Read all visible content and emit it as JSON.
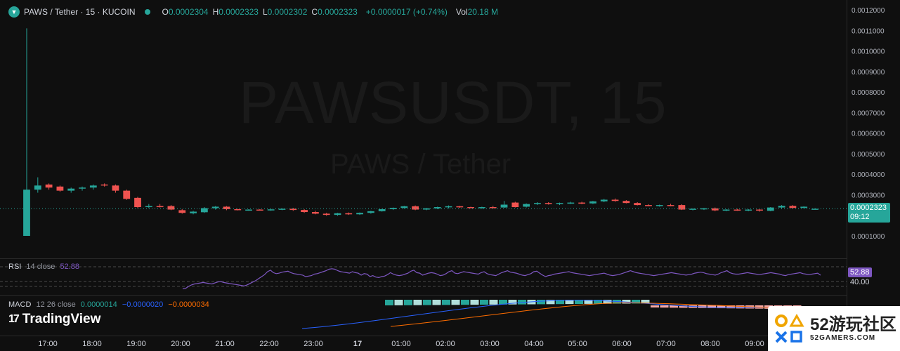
{
  "header": {
    "symbol_title": "PAWS / Tether · 15 · KUCOIN",
    "ohlc": [
      {
        "k": "O",
        "v": "0.0002304"
      },
      {
        "k": "H",
        "v": "0.0002323"
      },
      {
        "k": "L",
        "v": "0.0002302"
      },
      {
        "k": "C",
        "v": "0.0002323"
      }
    ],
    "change": "+0.0000017 (+0.74%)",
    "vol_label": "Vol",
    "vol_value": "20.18 M"
  },
  "watermark": {
    "line1": "PAWSUSDT, 15",
    "line2": "PAWS / Tether"
  },
  "price_tag": {
    "price": "0.0002323",
    "countdown": "09:12"
  },
  "rsi": {
    "label": "RSI",
    "params": "14 close",
    "value": "52.88",
    "level": "40.00"
  },
  "macd": {
    "label": "MACD",
    "params": "12 26 close",
    "hist": "0.0000014",
    "macd": "−0.0000020",
    "signal": "−0.0000034",
    "tag": "0.0000014"
  },
  "branding": {
    "tradingview": "TradingView",
    "badge_big": "52游玩社区",
    "badge_small": "52GAMERS.COM"
  },
  "colors": {
    "up": "#26a69a",
    "down": "#ef5350",
    "rsi": "#7e57c2",
    "macd": "#2962ff",
    "signal": "#ff6d00",
    "bg": "#0f0f0f"
  },
  "chart_data": [
    {
      "type": "candlestick",
      "title": "PAWSUSDT, 15",
      "ylim": [
        8e-05,
        0.00121
      ],
      "yticks": [
        "0.0012000",
        "0.0011000",
        "0.0010000",
        "0.0009000",
        "0.0008000",
        "0.0007000",
        "0.0006000",
        "0.0005000",
        "0.0004000",
        "0.0003000",
        "0.0001000"
      ],
      "xticks": [
        "17:00",
        "18:00",
        "19:00",
        "20:00",
        "21:00",
        "22:00",
        "23:00",
        "17",
        "01:00",
        "02:00",
        "03:00",
        "04:00",
        "05:00",
        "06:00",
        "07:00",
        "08:00",
        "09:00"
      ],
      "candles": [
        [
          0.0001,
          0.00111,
          0.0001,
          0.000325
        ],
        [
          0.000325,
          0.000385,
          0.00031,
          0.000345
        ],
        [
          0.00035,
          0.000355,
          0.000325,
          0.000335
        ],
        [
          0.00034,
          0.000345,
          0.000315,
          0.00032
        ],
        [
          0.00032,
          0.000335,
          0.00031,
          0.00033
        ],
        [
          0.00033,
          0.00034,
          0.00032,
          0.000335
        ],
        [
          0.000335,
          0.00035,
          0.000325,
          0.000345
        ],
        [
          0.00035,
          0.000355,
          0.00034,
          0.000345
        ],
        [
          0.000345,
          0.00035,
          0.00031,
          0.00032
        ],
        [
          0.00032,
          0.000325,
          0.000275,
          0.00028
        ],
        [
          0.000285,
          0.00029,
          0.000235,
          0.00024
        ],
        [
          0.00024,
          0.000255,
          0.000235,
          0.000245
        ],
        [
          0.000245,
          0.000255,
          0.000238,
          0.000242
        ],
        [
          0.000245,
          0.00025,
          0.000225,
          0.000228
        ],
        [
          0.000225,
          0.00023,
          0.000208,
          0.000212
        ],
        [
          0.00021,
          0.000222,
          0.000205,
          0.000218
        ],
        [
          0.000215,
          0.00024,
          0.000212,
          0.000235
        ],
        [
          0.000235,
          0.000245,
          0.000228,
          0.000242
        ],
        [
          0.000242,
          0.000245,
          0.000225,
          0.00023
        ],
        [
          0.00023,
          0.000232,
          0.000224,
          0.000226
        ],
        [
          0.000226,
          0.00023,
          0.000222,
          0.000228
        ],
        [
          0.000228,
          0.00023,
          0.000224,
          0.000226
        ],
        [
          0.000226,
          0.000232,
          0.000222,
          0.000229
        ],
        [
          0.000229,
          0.000234,
          0.000225,
          0.000232
        ],
        [
          0.000232,
          0.000236,
          0.000222,
          0.000226
        ],
        [
          0.000226,
          0.00023,
          0.000212,
          0.000216
        ],
        [
          0.000216,
          0.000222,
          0.000205,
          0.000208
        ],
        [
          0.000208,
          0.000212,
          0.000198,
          0.000202
        ],
        [
          0.000202,
          0.000212,
          0.000198,
          0.00021
        ],
        [
          0.00021,
          0.000214,
          0.000202,
          0.000205
        ],
        [
          0.000205,
          0.000214,
          0.000202,
          0.000212
        ],
        [
          0.000212,
          0.000222,
          0.000208,
          0.00022
        ],
        [
          0.00022,
          0.000232,
          0.000218,
          0.00023
        ],
        [
          0.00023,
          0.000238,
          0.000226,
          0.000236
        ],
        [
          0.000236,
          0.000246,
          0.000232,
          0.000244
        ],
        [
          0.000244,
          0.000248,
          0.000225,
          0.000228
        ],
        [
          0.000228,
          0.000236,
          0.000225,
          0.000234
        ],
        [
          0.000234,
          0.000242,
          0.00023,
          0.00024
        ],
        [
          0.00024,
          0.000248,
          0.000234,
          0.000244
        ],
        [
          0.000244,
          0.000246,
          0.000236,
          0.00024
        ],
        [
          0.00024,
          0.000242,
          0.000234,
          0.000236
        ],
        [
          0.000236,
          0.000242,
          0.000232,
          0.00024
        ],
        [
          0.00024,
          0.000246,
          0.000234,
          0.000238
        ],
        [
          0.000238,
          0.00027,
          0.000236,
          0.000252
        ],
        [
          0.000262,
          0.000266,
          0.000238,
          0.00024
        ],
        [
          0.000242,
          0.000258,
          0.000238,
          0.000255
        ],
        [
          0.000255,
          0.000264,
          0.00025,
          0.00026
        ],
        [
          0.00026,
          0.000264,
          0.000252,
          0.000256
        ],
        [
          0.000256,
          0.000262,
          0.00025,
          0.00026
        ],
        [
          0.00026,
          0.000266,
          0.000255,
          0.000262
        ],
        [
          0.000262,
          0.000266,
          0.000254,
          0.000258
        ],
        [
          0.000258,
          0.00027,
          0.000255,
          0.000268
        ],
        [
          0.000268,
          0.00028,
          0.000264,
          0.000276
        ],
        [
          0.000276,
          0.000282,
          0.000266,
          0.00027
        ],
        [
          0.00027,
          0.000274,
          0.000258,
          0.00026
        ],
        [
          0.00026,
          0.000264,
          0.000248,
          0.00025
        ],
        [
          0.00025,
          0.000254,
          0.000244,
          0.000248
        ],
        [
          0.000248,
          0.000252,
          0.000242,
          0.00025
        ],
        [
          0.00025,
          0.000256,
          0.000244,
          0.000248
        ],
        [
          0.00025,
          0.000254,
          0.000226,
          0.000228
        ],
        [
          0.000228,
          0.000234,
          0.000224,
          0.000232
        ],
        [
          0.000232,
          0.000236,
          0.000226,
          0.000234
        ],
        [
          0.000234,
          0.000238,
          0.00022,
          0.000224
        ],
        [
          0.000224,
          0.00023,
          0.00022,
          0.000228
        ],
        [
          0.000228,
          0.000232,
          0.000222,
          0.000226
        ],
        [
          0.000226,
          0.00023,
          0.00022,
          0.000228
        ],
        [
          0.000228,
          0.00023,
          0.000218,
          0.000224
        ],
        [
          0.000222,
          0.00024,
          0.00022,
          0.000238
        ],
        [
          0.000238,
          0.00025,
          0.000234,
          0.000246
        ],
        [
          0.000246,
          0.00025,
          0.000232,
          0.000236
        ],
        [
          0.000236,
          0.000244,
          0.000234,
          0.000242
        ],
        [
          0.000232,
          0.000234,
          0.00023,
          0.000232
        ]
      ]
    },
    {
      "type": "line",
      "title": "RSI 14 close",
      "ylim": [
        20,
        80
      ],
      "levels": [
        70,
        40,
        30
      ],
      "values": [
        25,
        26,
        30,
        33,
        35,
        36,
        37,
        38,
        37,
        36,
        35,
        37,
        39,
        40,
        38,
        37,
        36,
        35,
        34,
        33,
        32,
        31,
        33,
        36,
        39,
        42,
        46,
        50,
        54,
        60,
        63,
        58,
        56,
        57,
        59,
        60,
        61,
        58,
        56,
        55,
        54,
        53,
        50,
        51,
        52,
        55,
        56,
        58,
        60,
        62,
        65,
        66,
        65,
        62,
        60,
        59,
        58,
        57,
        60,
        58,
        57,
        53,
        56,
        55,
        50,
        52,
        49,
        48,
        50,
        51,
        54,
        58,
        55,
        53,
        52,
        53,
        55,
        57,
        61,
        63,
        58,
        57,
        53,
        55,
        57,
        58,
        57,
        55,
        52,
        53,
        56,
        60,
        62,
        57,
        56,
        58,
        60,
        59,
        58,
        57,
        56,
        55,
        58,
        60,
        56,
        54,
        53,
        52,
        55,
        58,
        60,
        62,
        59,
        58,
        57,
        55,
        53,
        52,
        54,
        56,
        60,
        61,
        57,
        53,
        50,
        52,
        53,
        55,
        56,
        57,
        58,
        59,
        60,
        58,
        57,
        56,
        55,
        54,
        53,
        52,
        53,
        54,
        55,
        56,
        57,
        55,
        53,
        52,
        53,
        54,
        56,
        58,
        60,
        62,
        60,
        58,
        57,
        56,
        55,
        54,
        53,
        52,
        53,
        54,
        55,
        56,
        57,
        58,
        57,
        56,
        55,
        54,
        53,
        54,
        55,
        57,
        58,
        59,
        58,
        56,
        55,
        54,
        53,
        55,
        58,
        60,
        62,
        58,
        56,
        55,
        55,
        56,
        57,
        58,
        57,
        56,
        55,
        54,
        55,
        56,
        57,
        58,
        57,
        56,
        55,
        53,
        52,
        54,
        55,
        56,
        57,
        58,
        56,
        55,
        54,
        55,
        56,
        57,
        52.88
      ]
    }
  ]
}
